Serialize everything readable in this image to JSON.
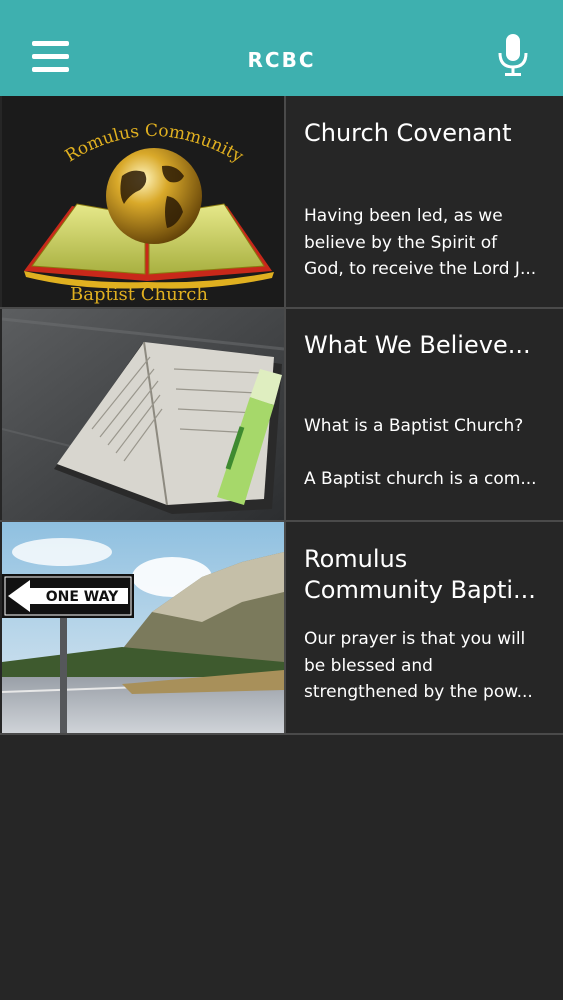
{
  "header": {
    "title": "RCBC",
    "menu_icon": "hamburger-menu-icon",
    "mic_icon": "microphone-icon",
    "color": "#3eb0af"
  },
  "items": [
    {
      "image_logo_top": "Romulus Community",
      "image_logo_bottom": "Baptist Church",
      "title_lines": [
        "Church Covenant"
      ],
      "desc_lines": [
        "Having been led, as we",
        "believe by the Spirit of",
        "God, to receive the Lord J..."
      ]
    },
    {
      "title_lines": [
        "What We Believe..."
      ],
      "desc_lines": [
        "What is a Baptist Church?",
        "",
        "A Baptist church is a com..."
      ]
    },
    {
      "image_sign": "ONE WAY",
      "title_lines": [
        "Romulus",
        "Community Bapti..."
      ],
      "desc_lines": [
        "Our prayer is that you will",
        "be blessed and",
        "strengthened by the pow..."
      ]
    }
  ]
}
